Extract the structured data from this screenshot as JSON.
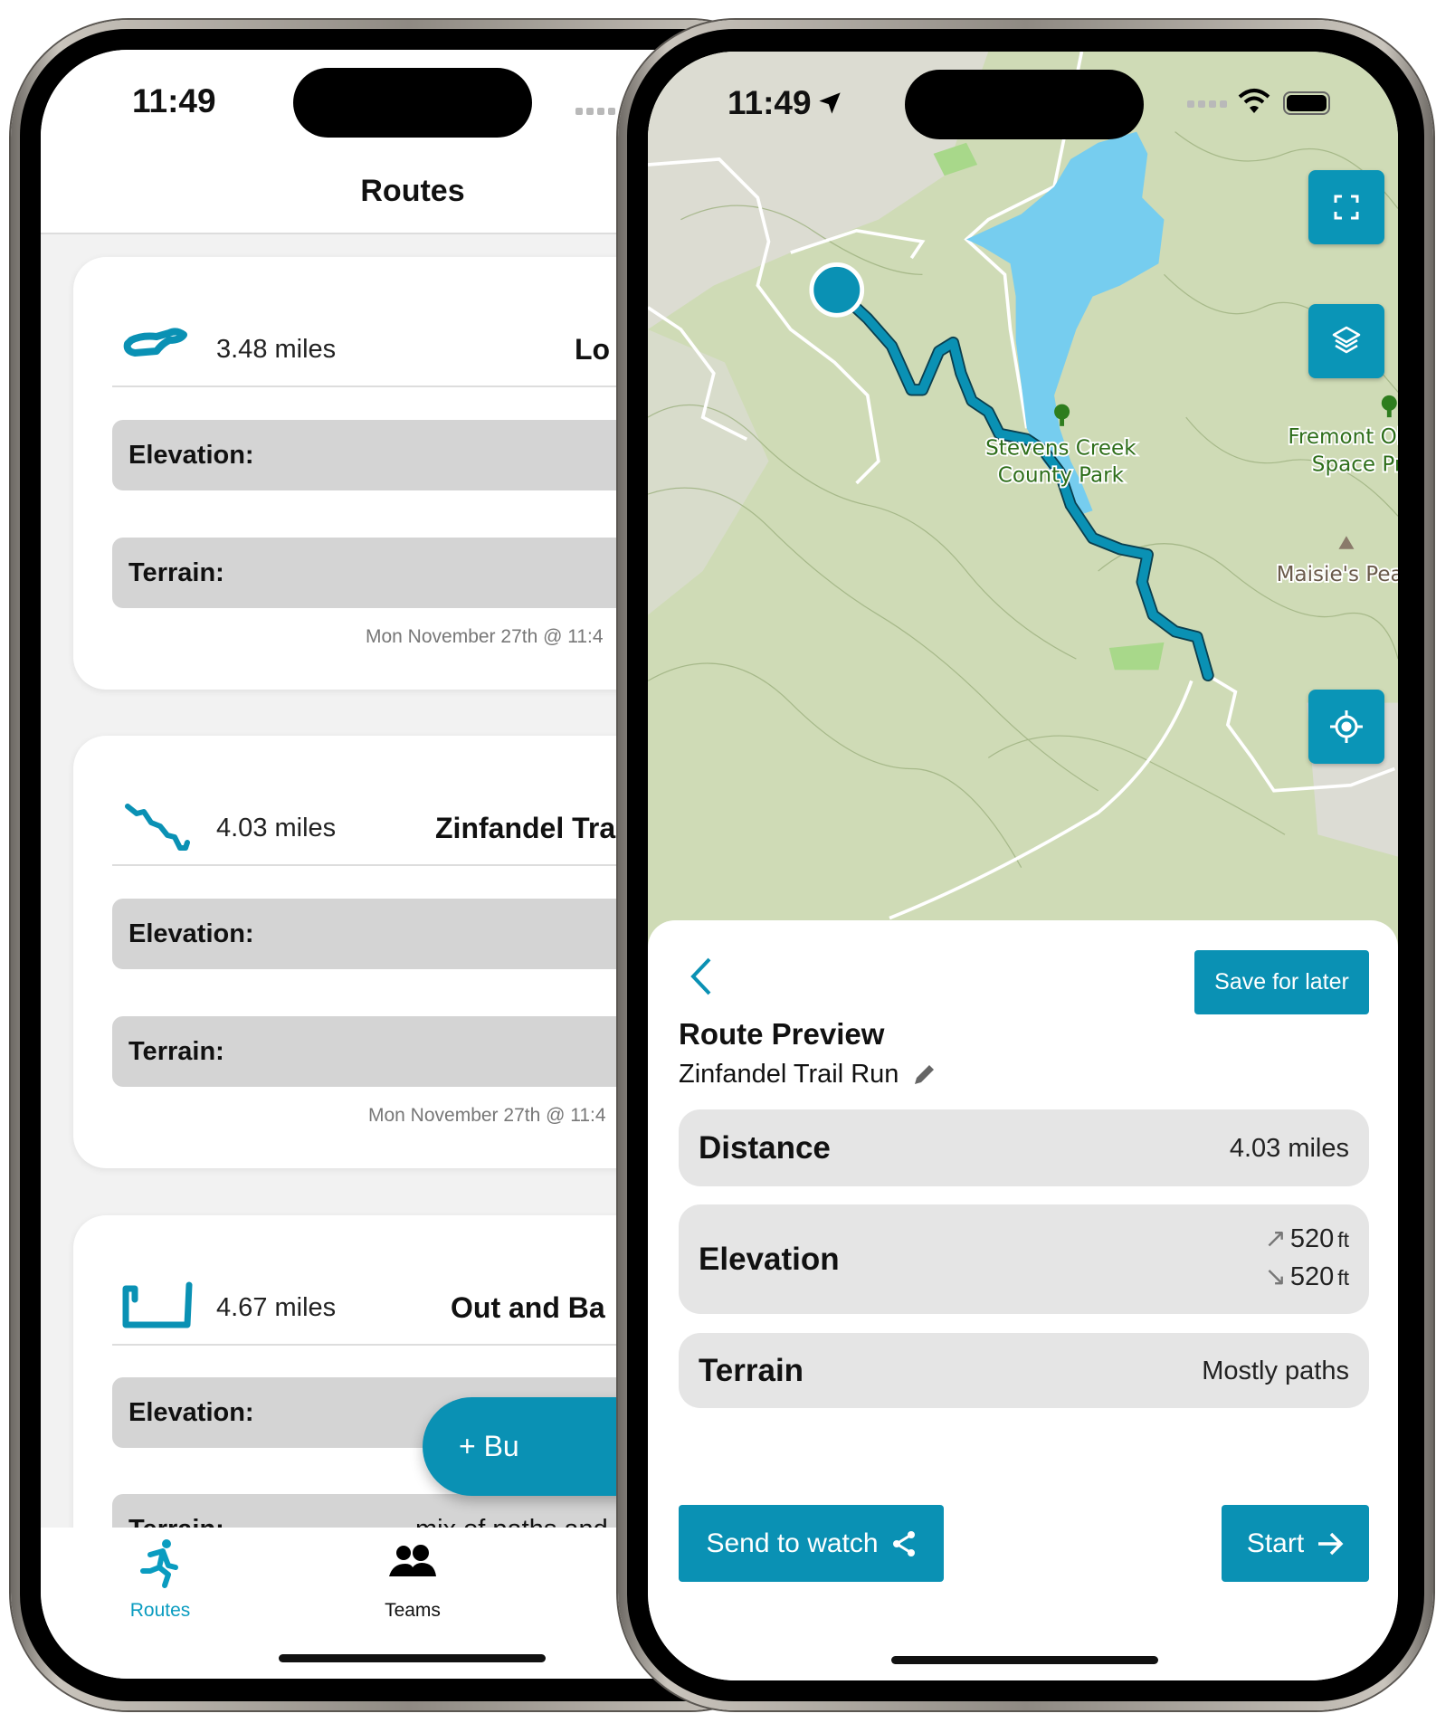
{
  "colors": {
    "accent": "#0a91b4",
    "card_field": "#d4d4d4",
    "sheet_row": "#e5e5e5",
    "list_bg": "#f2f2f2"
  },
  "left_phone": {
    "status": {
      "time": "11:49"
    },
    "title": "Routes",
    "routes": [
      {
        "distance": "3.48 miles",
        "name": "Lo",
        "elevation_label": "Elevation:",
        "terrain_label": "Terrain:",
        "date": "Mon November 27th @ 11:4"
      },
      {
        "distance": "4.03 miles",
        "name": "Zinfandel Tra",
        "elevation_label": "Elevation:",
        "terrain_label": "Terrain:",
        "date": "Mon November 27th @ 11:4"
      },
      {
        "distance": "4.67 miles",
        "name": "Out and Ba",
        "elevation_label": "Elevation:",
        "terrain_label": "Terrain:",
        "terrain_value": "mix of paths and"
      }
    ],
    "fab_label": "+ Bu",
    "tabs": [
      {
        "label": "Routes",
        "icon": "running-icon",
        "active": true
      },
      {
        "label": "Teams",
        "icon": "people-icon",
        "active": false
      }
    ]
  },
  "right_phone": {
    "status": {
      "time": "11:49"
    },
    "map": {
      "labels": {
        "park1_line1": "Stevens Creek",
        "park1_line2": "County Park",
        "park2_line1": "Fremont Ol",
        "park2_line2": "Space Pr",
        "peak": "Maisie's Pea"
      },
      "buttons": [
        "fullscreen-icon",
        "layers-icon",
        "locate-icon"
      ]
    },
    "sheet": {
      "save_label": "Save for later",
      "title": "Route Preview",
      "route_name": "Zinfandel Trail Run",
      "distance_label": "Distance",
      "distance_value": "4.03 miles",
      "elevation_label": "Elevation",
      "elevation_up": "520",
      "elevation_down": "520",
      "elevation_unit": "ft",
      "terrain_label": "Terrain",
      "terrain_value": "Mostly paths",
      "send_label": "Send to watch",
      "start_label": "Start"
    }
  }
}
